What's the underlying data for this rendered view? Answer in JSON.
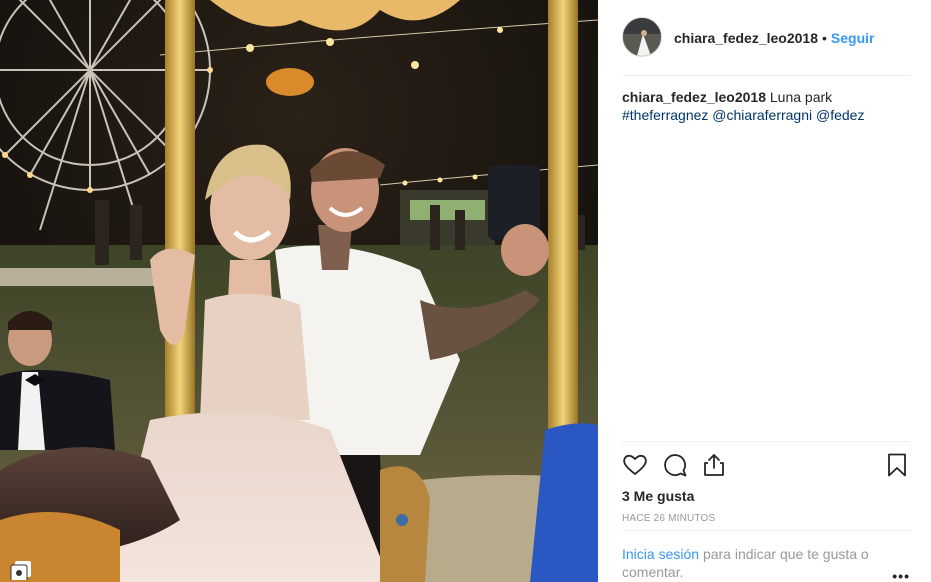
{
  "post": {
    "username": "chiara_fedez_leo2018",
    "separator": "•",
    "follow_label": "Seguir",
    "caption": {
      "username": "chiara_fedez_leo2018",
      "text": "Luna park",
      "hashtag": "#theferragnez",
      "mention_1": "@chiaraferragni",
      "mention_2": "@fedez"
    },
    "likes_text": "3 Me gusta",
    "timestamp": "HACE 26 MINUTOS",
    "login_link": "Inicia sesión",
    "login_suffix": "para indicar que te gusta o comentar.",
    "more_label": "•••"
  },
  "icons": {
    "like": "heart-icon",
    "comment": "comment-icon",
    "share": "share-icon",
    "save": "bookmark-icon",
    "media": "multi-photo-icon"
  },
  "colors": {
    "link": "#3897f0",
    "mention": "#003569",
    "muted": "#999999",
    "text": "#262626"
  }
}
